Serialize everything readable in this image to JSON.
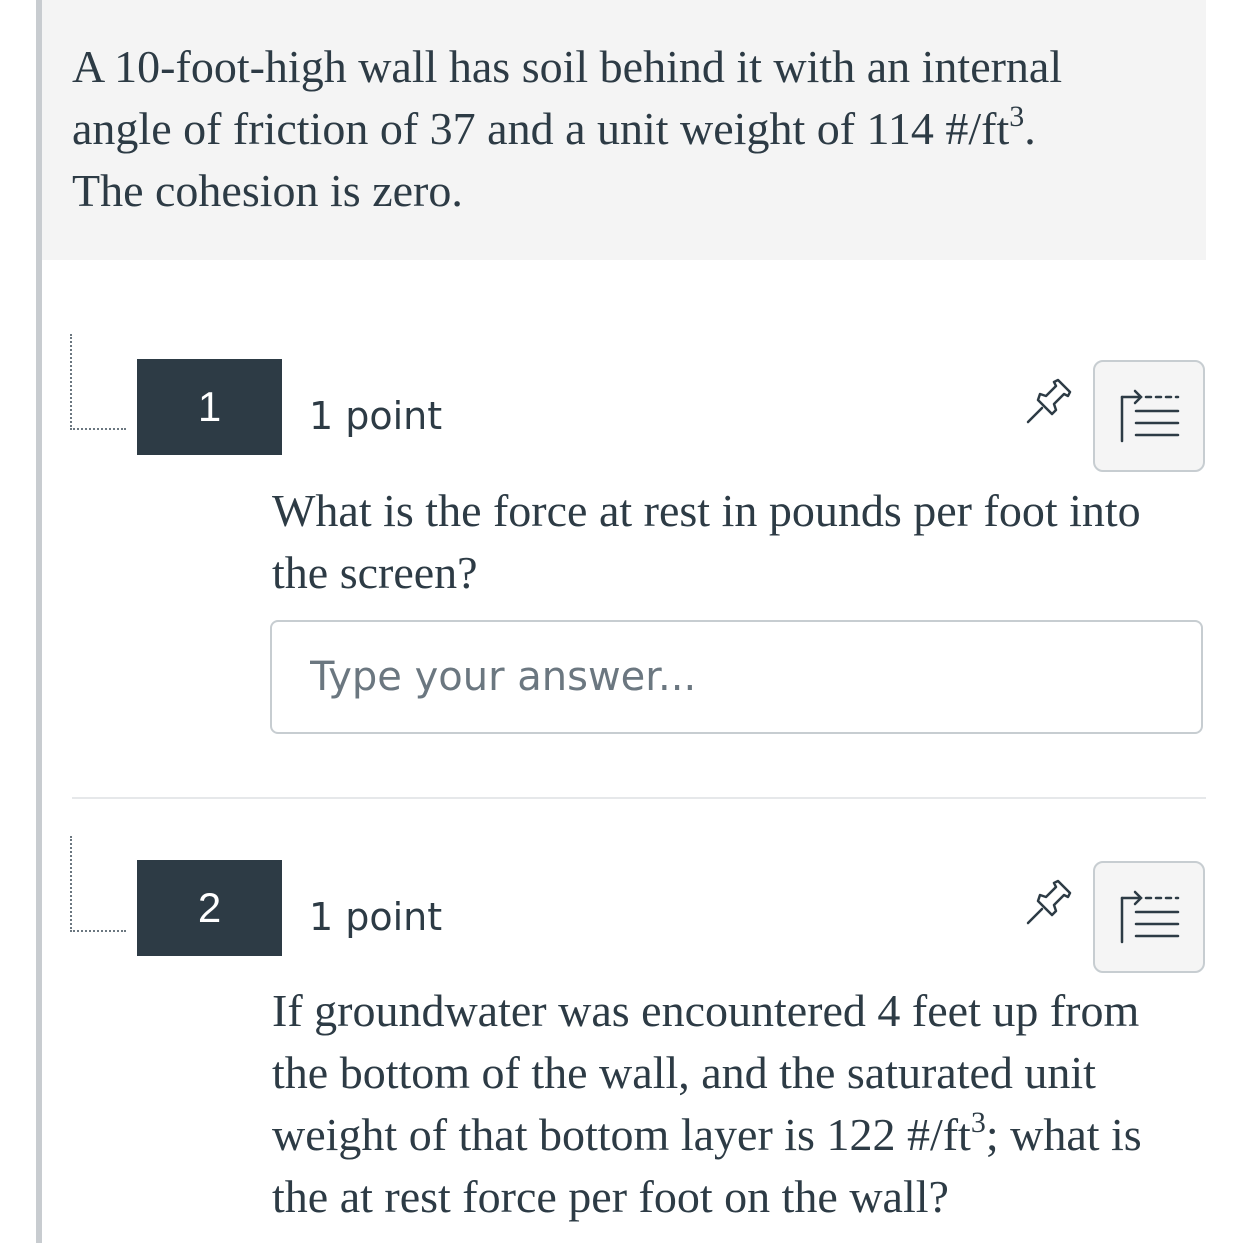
{
  "stimulus": {
    "line1": "A 10-foot-high wall has soil behind it with an internal",
    "line2_pre": "angle of friction of 37 and a unit weight of 114 #/ft",
    "line2_sup": "3",
    "line2_post": ".",
    "line3": "The cohesion is zero."
  },
  "questions": [
    {
      "number": "1",
      "points": "1 point",
      "text": "What is the force at rest in pounds per foot into the screen?",
      "answer_placeholder": "Type your answer...",
      "answer_value": ""
    },
    {
      "number": "2",
      "points": "1 point",
      "text_pre": "If groundwater was encountered 4 feet up from the bottom of the wall, and the saturated unit weight of that bottom layer is 122 #/ft",
      "text_sup": "3",
      "text_post": "; what is the at rest force per foot on the wall?"
    }
  ],
  "icons": {
    "pin": "pin-icon",
    "flag": "flag-question-icon"
  },
  "colors": {
    "text": "#2d3b45",
    "badge": "#2d3b45",
    "stimulus_bg": "#f4f4f4"
  }
}
